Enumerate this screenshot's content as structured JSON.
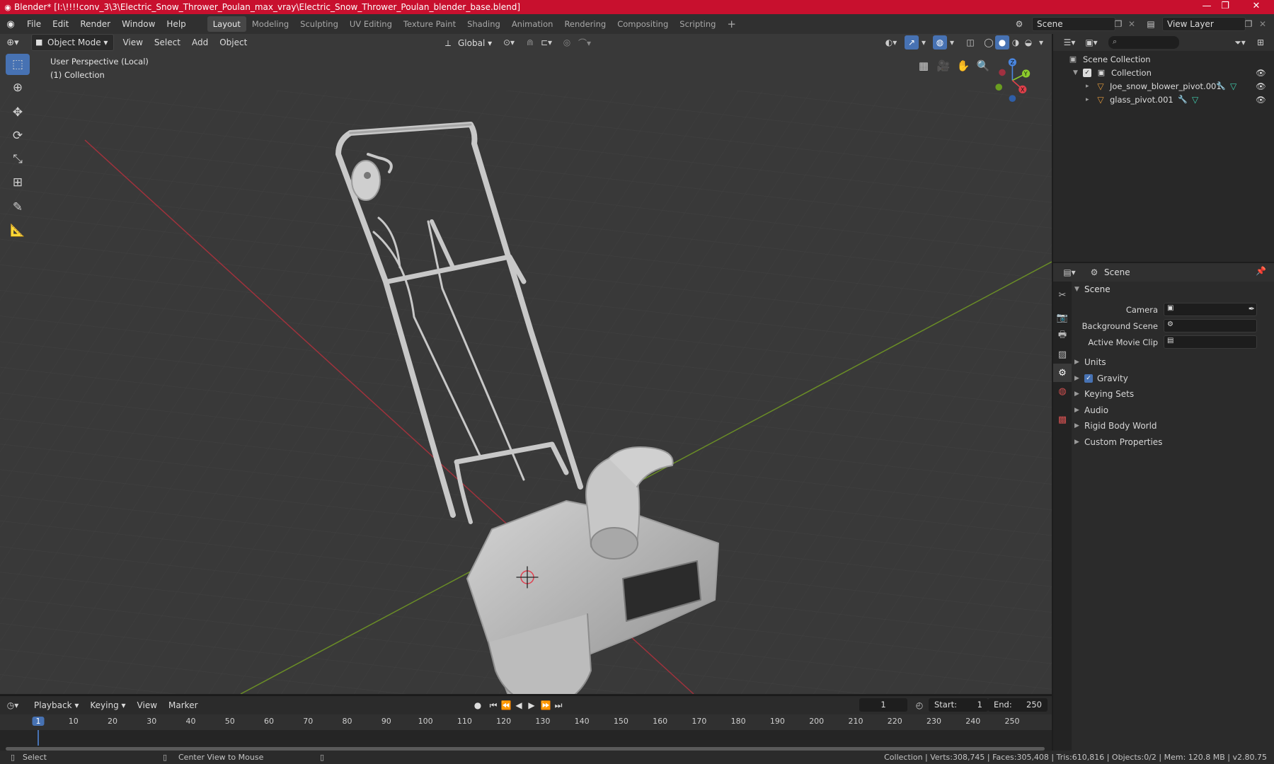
{
  "window": {
    "title": "Blender* [I:\\!!!!conv_3\\3\\Electric_Snow_Thrower_Poulan_max_vray\\Electric_Snow_Thrower_Poulan_blender_base.blend]",
    "minimize": "—",
    "maximize": "❐",
    "close": "✕"
  },
  "menu": {
    "items": [
      "File",
      "Edit",
      "Render",
      "Window",
      "Help"
    ],
    "workspaces": [
      "Layout",
      "Modeling",
      "Sculpting",
      "UV Editing",
      "Texture Paint",
      "Shading",
      "Animation",
      "Rendering",
      "Compositing",
      "Scripting"
    ],
    "active_workspace": "Layout",
    "add_workspace": "+",
    "scene": "Scene",
    "view_layer": "View Layer"
  },
  "viewport": {
    "mode": "Object Mode",
    "menus": [
      "View",
      "Select",
      "Add",
      "Object"
    ],
    "transform_orientation": "Global",
    "info_line1": "User Perspective (Local)",
    "info_line2": "(1) Collection",
    "gizmo_axes": [
      "X",
      "Y",
      "Z"
    ]
  },
  "outliner": {
    "root": "Scene Collection",
    "collection": "Collection",
    "objects": [
      "Joe_snow_blower_pivot.001",
      "glass_pivot.001"
    ]
  },
  "properties": {
    "context": "Scene",
    "panel": "Scene",
    "fields": [
      {
        "label": "Camera",
        "value": ""
      },
      {
        "label": "Background Scene",
        "value": ""
      },
      {
        "label": "Active Movie Clip",
        "value": ""
      }
    ],
    "subpanels": [
      "Units",
      "Gravity",
      "Keying Sets",
      "Audio",
      "Rigid Body World",
      "Custom Properties"
    ],
    "gravity_enabled": true
  },
  "timeline": {
    "menus": [
      "Playback",
      "Keying",
      "View",
      "Marker"
    ],
    "current_frame": "1",
    "start_label": "Start:",
    "start": "1",
    "end_label": "End:",
    "end": "250",
    "ticks": [
      "1",
      "10",
      "20",
      "30",
      "40",
      "50",
      "60",
      "70",
      "80",
      "90",
      "100",
      "110",
      "120",
      "130",
      "140",
      "150",
      "160",
      "170",
      "180",
      "190",
      "200",
      "210",
      "220",
      "230",
      "240",
      "250"
    ]
  },
  "status": {
    "left_action": "Select",
    "mid_action": "Center View to Mouse",
    "stats": "Collection | Verts:308,745 | Faces:305,408 | Tris:610,816 | Objects:0/2 | Mem: 120.8 MB | v2.80.75"
  },
  "colors": {
    "titlebar": "#c8102e",
    "accent": "#4772b3",
    "x_axis": "#e0404a",
    "y_axis": "#8ccc2c",
    "z_axis": "#4a86e0"
  }
}
